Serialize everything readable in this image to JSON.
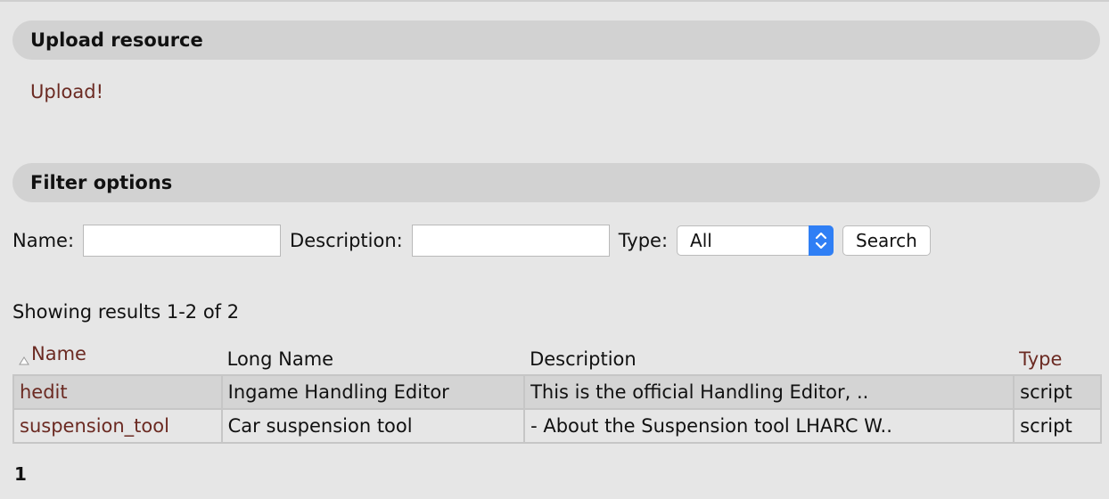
{
  "upload": {
    "header": "Upload resource",
    "link_label": "Upload!"
  },
  "filter": {
    "header": "Filter options",
    "name_label": "Name:",
    "name_value": "",
    "description_label": "Description:",
    "description_value": "",
    "type_label": "Type:",
    "type_selected": "All",
    "search_label": "Search"
  },
  "results": {
    "summary": "Showing results 1-2 of 2",
    "columns": {
      "name": "Name",
      "long_name": "Long Name",
      "description": "Description",
      "type": "Type"
    },
    "rows": [
      {
        "name": "hedit",
        "long_name": "Ingame Handling Editor",
        "description": "This is the official Handling Editor, ..",
        "type": "script"
      },
      {
        "name": "suspension_tool",
        "long_name": "Car suspension tool",
        "description": "- About the Suspension tool LHARC W..",
        "type": "script"
      }
    ]
  },
  "pagination": {
    "current_page": "1"
  },
  "icons": {
    "sort": "sort-ascending-icon",
    "select": "chevron-up-down-icon"
  },
  "colors": {
    "background": "#e6e6e6",
    "section_header": "#d2d2d2",
    "link": "#6b2a22",
    "select_accent": "#2f7ff5"
  }
}
